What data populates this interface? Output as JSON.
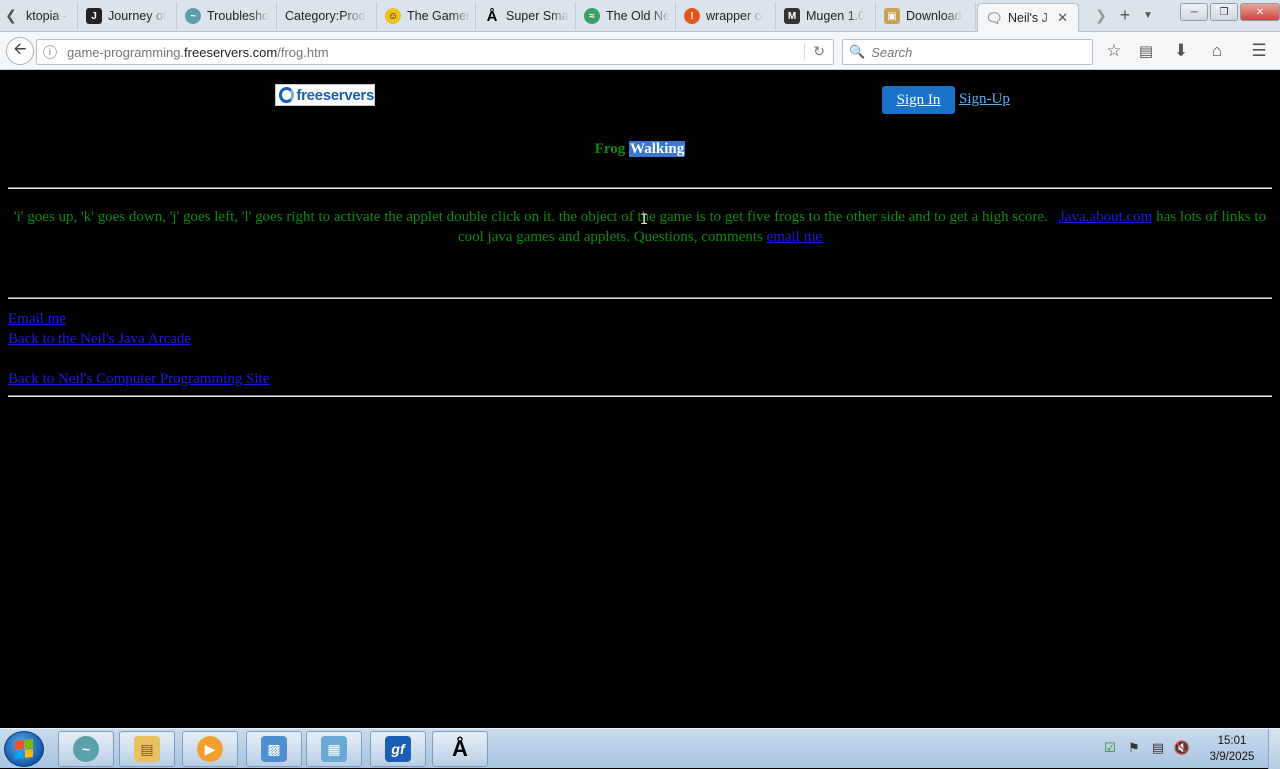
{
  "tabs": [
    {
      "label": "ktopia -",
      "favicon": "none"
    },
    {
      "label": "Journey of",
      "favicon": "j-icon"
    },
    {
      "label": "Troublesho",
      "favicon": "swirl-icon"
    },
    {
      "label": "Category:Prod",
      "favicon": "none"
    },
    {
      "label": "The Gamer",
      "favicon": "smiley-icon"
    },
    {
      "label": "Super Sma",
      "favicon": "hook-icon"
    },
    {
      "label": "The Old Ne",
      "favicon": "globe-icon"
    },
    {
      "label": "wrapper o",
      "favicon": "orange-circle-icon"
    },
    {
      "label": "Mugen 1.0",
      "favicon": "m-icon"
    },
    {
      "label": "Download",
      "favicon": "page-icon"
    },
    {
      "label": "Neil's J",
      "favicon": "speech-bubble-icon"
    }
  ],
  "browser": {
    "url_host": "game-programming.",
    "url_domain": "freeservers.com",
    "url_path": "/frog.htm",
    "search_placeholder": "Search"
  },
  "page": {
    "logo_text": "freeservers",
    "signin_label": "Sign In",
    "signup_label": "Sign-Up",
    "title_plain": "Frog",
    "title_selected": "Walking",
    "description": "'i' goes up, 'k' goes down, 'j' goes left, 'l' goes right to activate the applet double click on it. the object of the game is to get five frogs to the other side and to get a high score.",
    "desc_link": "Java.about.com",
    "desc_after_link": " has lots of links to cool java games and applets. Questions, comments ",
    "desc_email_link": "email me",
    "links": {
      "email": "Email me",
      "arcade": "Back to the Neil's Java Arcade",
      "site": "Back to Neil's Computer Programming Site"
    }
  },
  "taskbar": {
    "clock_time": "15:01",
    "clock_date": "3/9/2025"
  },
  "colors": {
    "page_text_green": "#0b8a0b",
    "link_blue": "#1a1ae6",
    "selection_blue": "#3a78d6",
    "signin_blue": "#1a73c8"
  }
}
